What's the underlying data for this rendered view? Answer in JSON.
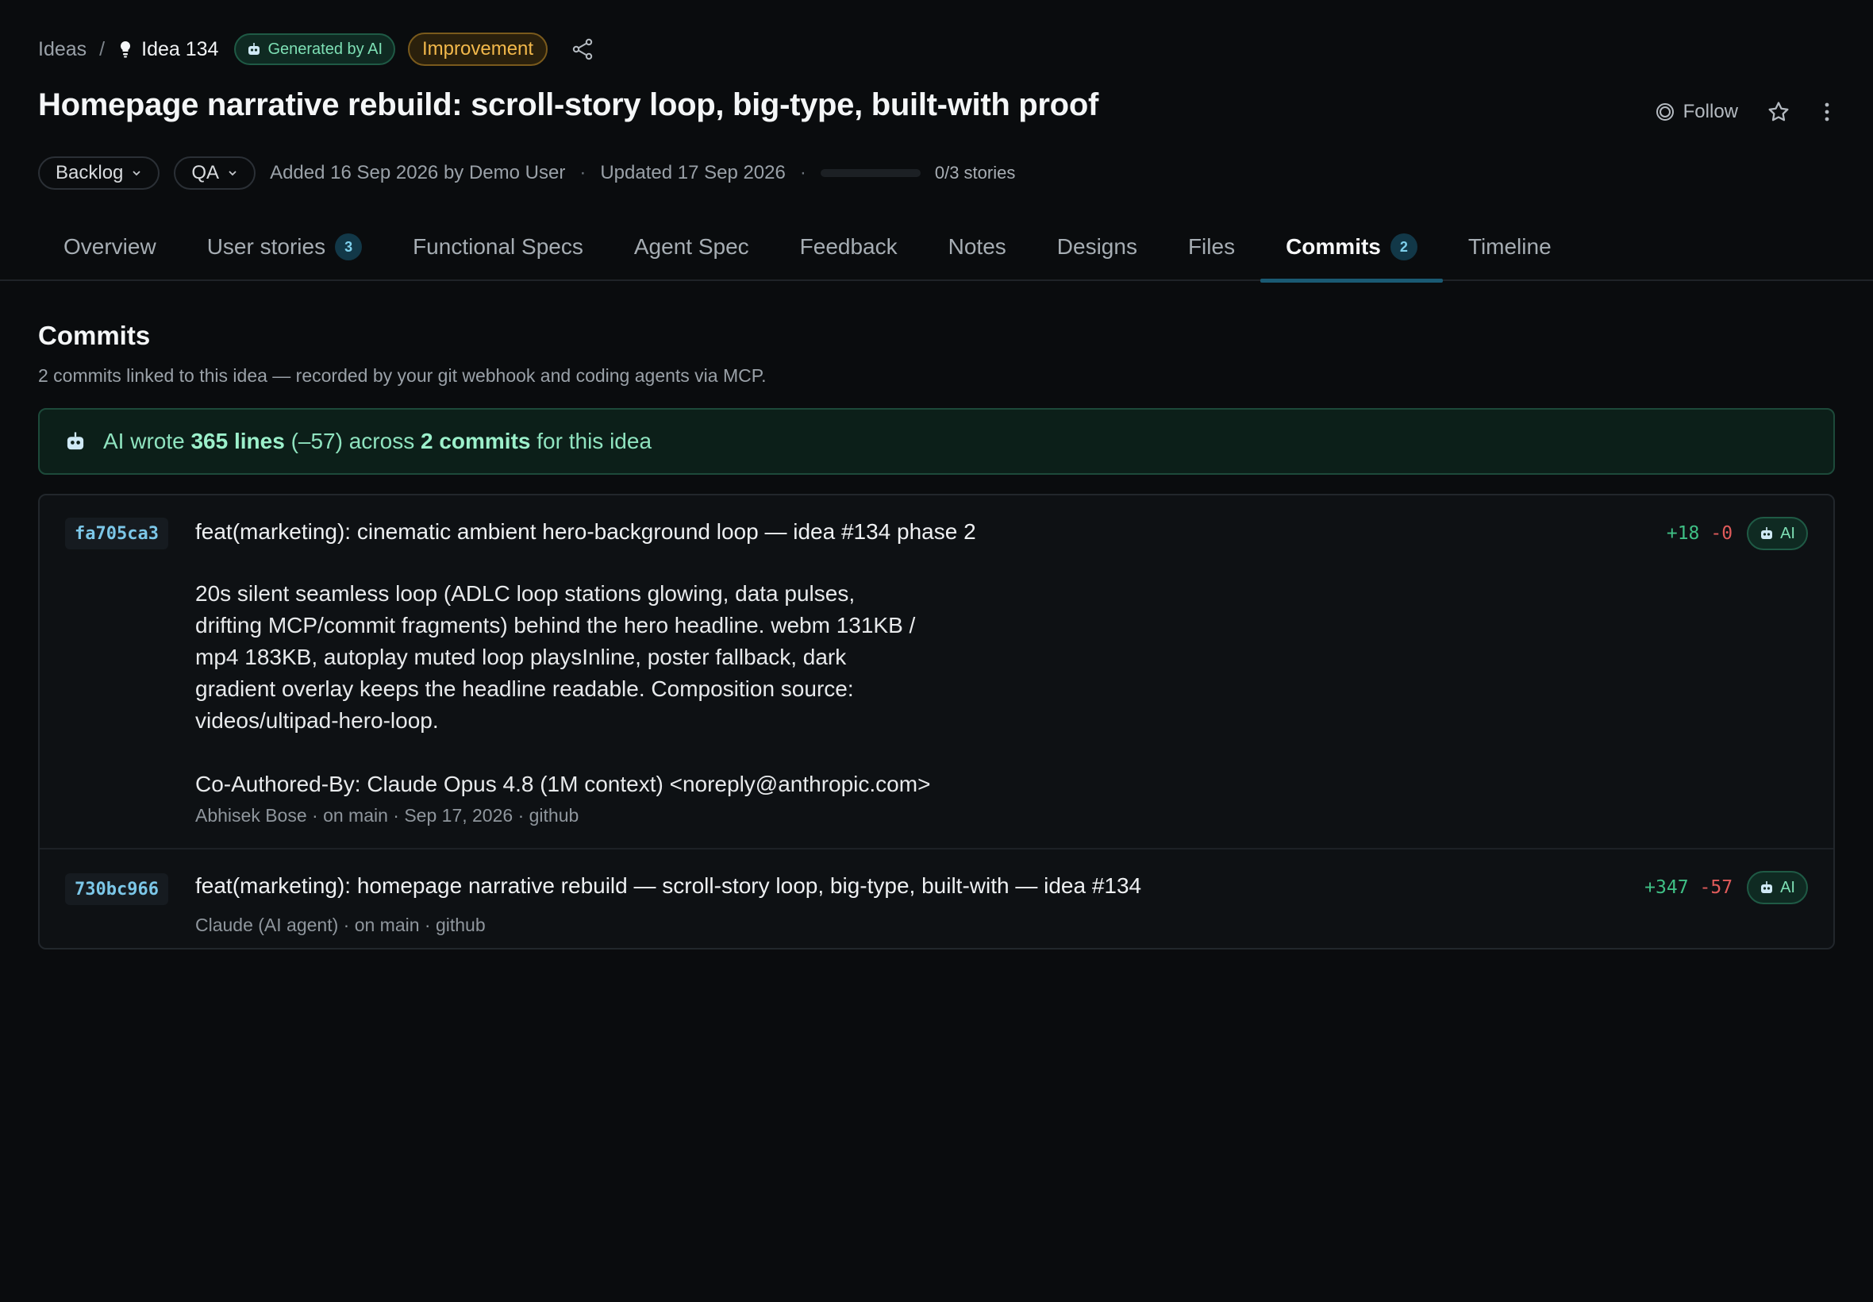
{
  "breadcrumb": {
    "root": "Ideas",
    "separator": "/",
    "current": "Idea 134",
    "ai_badge": "Generated by AI",
    "type_badge": "Improvement"
  },
  "header": {
    "title": "Homepage narrative rebuild: scroll-story loop, big-type, built-with proof",
    "follow_label": "Follow"
  },
  "meta": {
    "status": "Backlog",
    "stage": "QA",
    "added": "Added 16 Sep 2026 by Demo User",
    "separator": "·",
    "updated": "Updated 17 Sep 2026",
    "stories_progress": 0,
    "stories_label": "0/3 stories"
  },
  "tabs": [
    {
      "label": "Overview"
    },
    {
      "label": "User stories",
      "badge": "3"
    },
    {
      "label": "Functional Specs"
    },
    {
      "label": "Agent Spec"
    },
    {
      "label": "Feedback"
    },
    {
      "label": "Notes"
    },
    {
      "label": "Designs"
    },
    {
      "label": "Files"
    },
    {
      "label": "Commits",
      "badge": "2",
      "active": true
    },
    {
      "label": "Timeline"
    }
  ],
  "section": {
    "title": "Commits",
    "subtitle": "2 commits linked to this idea — recorded by your git webhook and coding agents via MCP."
  },
  "ai_summary": {
    "prefix": "AI wrote",
    "lines": "365 lines",
    "removed": "(–57) across",
    "commits": "2 commits",
    "suffix": "for this idea"
  },
  "commits": [
    {
      "sha": "fa705ca3",
      "message": "feat(marketing): cinematic ambient hero-background loop — idea #134 phase 2",
      "body": "20s silent seamless loop (ADLC loop stations glowing, data pulses,\ndrifting MCP/commit fragments) behind the hero headline. webm 131KB /\nmp4 183KB, autoplay muted loop playsInline, poster fallback, dark\ngradient overlay keeps the headline readable. Composition source:\nvideos/ultipad-hero-loop.\n\nCo-Authored-By: Claude Opus 4.8 (1M context) <noreply@anthropic.com>",
      "byline": "Abhisek Bose · on main · Sep 17, 2026 · github",
      "additions": "+18",
      "deletions": "-0",
      "ai_label": "AI"
    },
    {
      "sha": "730bc966",
      "message": "feat(marketing): homepage narrative rebuild — scroll-story loop, big-type, built-with — idea #134",
      "byline": "Claude (AI agent) · on main · github",
      "additions": "+347",
      "deletions": "-57",
      "ai_label": "AI"
    }
  ],
  "colors": {
    "background": "#0a0c0e",
    "ai_green": "#7ee0b5",
    "improvement_amber": "#f2b84b",
    "additions": "#3fbf85",
    "deletions": "#e05b5b",
    "sha": "#7cc7e8"
  },
  "icons": {
    "breadcrumb": "lightbulb-icon",
    "ai": "robot-icon",
    "share": "share-icon",
    "follow": "eye-icon",
    "star": "star-icon",
    "more": "more-vertical-icon",
    "dropdown": "chevron-down-icon"
  }
}
